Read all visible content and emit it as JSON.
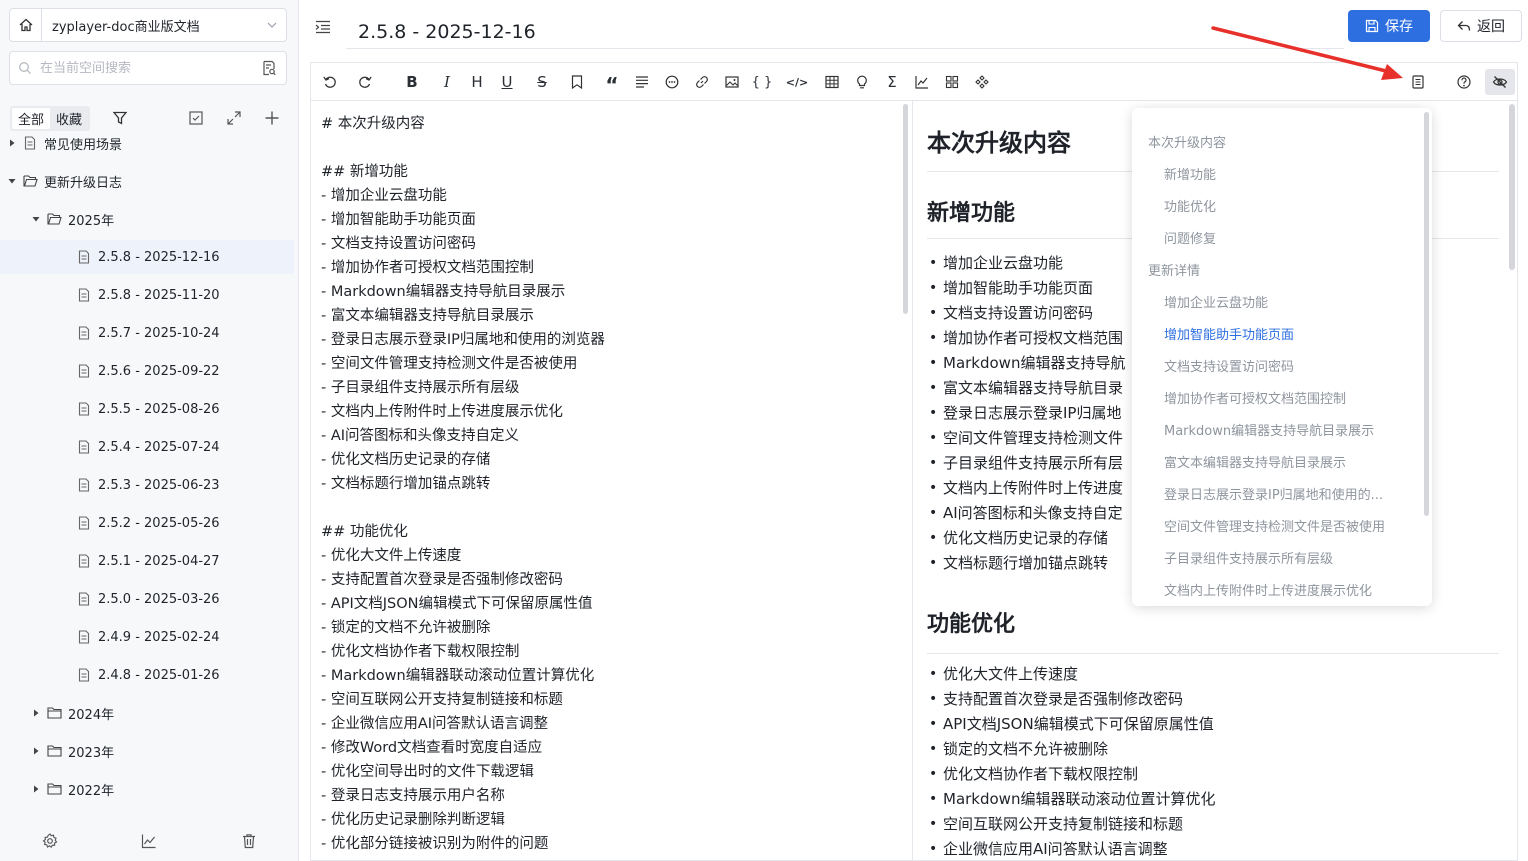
{
  "space": {
    "name": "zyplayer-doc商业版文档"
  },
  "search": {
    "placeholder": "在当前空间搜索"
  },
  "filter": {
    "tab_all": "全部",
    "tab_fav": "收藏"
  },
  "tree": {
    "items": [
      {
        "label": "常见使用场景",
        "type": "folder",
        "expanded": false
      },
      {
        "label": "更新升级日志",
        "type": "folder",
        "expanded": true
      },
      {
        "label": "2025年",
        "type": "folder",
        "expanded": true
      },
      {
        "label": "2.5.8 - 2025-12-16",
        "type": "doc",
        "selected": true
      },
      {
        "label": "2.5.8 - 2025-11-20",
        "type": "doc"
      },
      {
        "label": "2.5.7 - 2025-10-24",
        "type": "doc"
      },
      {
        "label": "2.5.6 - 2025-09-22",
        "type": "doc"
      },
      {
        "label": "2.5.5 - 2025-08-26",
        "type": "doc"
      },
      {
        "label": "2.5.4 - 2025-07-24",
        "type": "doc"
      },
      {
        "label": "2.5.3 - 2025-06-23",
        "type": "doc"
      },
      {
        "label": "2.5.2 - 2025-05-26",
        "type": "doc"
      },
      {
        "label": "2.5.1 - 2025-04-27",
        "type": "doc"
      },
      {
        "label": "2.5.0 - 2025-03-26",
        "type": "doc"
      },
      {
        "label": "2.4.9 - 2025-02-24",
        "type": "doc"
      },
      {
        "label": "2.4.8 - 2025-01-26",
        "type": "doc"
      },
      {
        "label": "2024年",
        "type": "folder",
        "expanded": false
      },
      {
        "label": "2023年",
        "type": "folder",
        "expanded": false
      },
      {
        "label": "2022年",
        "type": "folder",
        "expanded": false
      }
    ]
  },
  "header": {
    "title": "2.5.8 - 2025-12-16",
    "save_label": "保存",
    "back_label": "返回"
  },
  "toolbar": {
    "bold": "B",
    "italic": "I",
    "heading": "H",
    "underline": "U",
    "strike": "S",
    "quote": "“",
    "code_block": "{ }",
    "code_inline": "</>",
    "formula": "Σ"
  },
  "editor": {
    "source": "# 本次升级内容\n\n## 新增功能\n- 增加企业云盘功能\n- 增加智能助手功能页面\n- 文档支持设置访问密码\n- 增加协作者可授权文档范围控制\n- Markdown编辑器支持导航目录展示\n- 富文本编辑器支持导航目录展示\n- 登录日志展示登录IP归属地和使用的浏览器\n- 空间文件管理支持检测文件是否被使用\n- 子目录组件支持展示所有层级\n- 文档内上传附件时上传进度展示优化\n- AI问答图标和头像支持自定义\n- 优化文档历史记录的存储\n- 文档标题行增加锚点跳转\n\n## 功能优化\n- 优化大文件上传速度\n- 支持配置首次登录是否强制修改密码\n- API文档JSON编辑模式下可保留原属性值\n- 锁定的文档不允许被删除\n- 优化文档协作者下载权限控制\n- Markdown编辑器联动滚动位置计算优化\n- 空间互联网公开支持复制链接和标题\n- 企业微信应用AI问答默认语言调整\n- 修改Word文档查看时宽度自适应\n- 优化空间导出时的文件下载逻辑\n- 登录日志支持展示用户名称\n- 优化历史记录删除判断逻辑\n- 优化部分链接被识别为附件的问题"
  },
  "preview": {
    "h1": "本次升级内容",
    "h2_new": "新增功能",
    "new_items": [
      "增加企业云盘功能",
      "增加智能助手功能页面",
      "文档支持设置访问密码",
      "增加协作者可授权文档范围",
      "Markdown编辑器支持导航",
      "富文本编辑器支持导航目录",
      "登录日志展示登录IP归属地",
      "空间文件管理支持检测文件",
      "子目录组件支持展示所有层",
      "文档内上传附件时上传进度",
      "AI问答图标和头像支持自定",
      "优化文档历史记录的存储",
      "文档标题行增加锚点跳转"
    ],
    "h2_opt": "功能优化",
    "opt_items": [
      "优化大文件上传速度",
      "支持配置首次登录是否强制修改密码",
      "API文档JSON编辑模式下可保留原属性值",
      "锁定的文档不允许被删除",
      "优化文档协作者下载权限控制",
      "Markdown编辑器联动滚动位置计算优化",
      "空间互联网公开支持复制链接和标题",
      "企业微信应用AI问答默认语言调整"
    ]
  },
  "toc": {
    "items": [
      {
        "label": "本次升级内容",
        "level": 1
      },
      {
        "label": "新增功能",
        "level": 2
      },
      {
        "label": "功能优化",
        "level": 2
      },
      {
        "label": "问题修复",
        "level": 2
      },
      {
        "label": "更新详情",
        "level": 1
      },
      {
        "label": "增加企业云盘功能",
        "level": 2
      },
      {
        "label": "增加智能助手功能页面",
        "level": 2,
        "active": true
      },
      {
        "label": "文档支持设置访问密码",
        "level": 2
      },
      {
        "label": "增加协作者可授权文档范围控制",
        "level": 2
      },
      {
        "label": "Markdown编辑器支持导航目录展示",
        "level": 2
      },
      {
        "label": "富文本编辑器支持导航目录展示",
        "level": 2
      },
      {
        "label": "登录日志展示登录IP归属地和使用的...",
        "level": 2
      },
      {
        "label": "空间文件管理支持检测文件是否被使用",
        "level": 2
      },
      {
        "label": "子目录组件支持展示所有层级",
        "level": 2
      },
      {
        "label": "文档内上传附件时上传进度展示优化",
        "level": 2
      }
    ]
  },
  "colors": {
    "accent": "#2d6fe0",
    "annotation_arrow": "#e8302a"
  }
}
